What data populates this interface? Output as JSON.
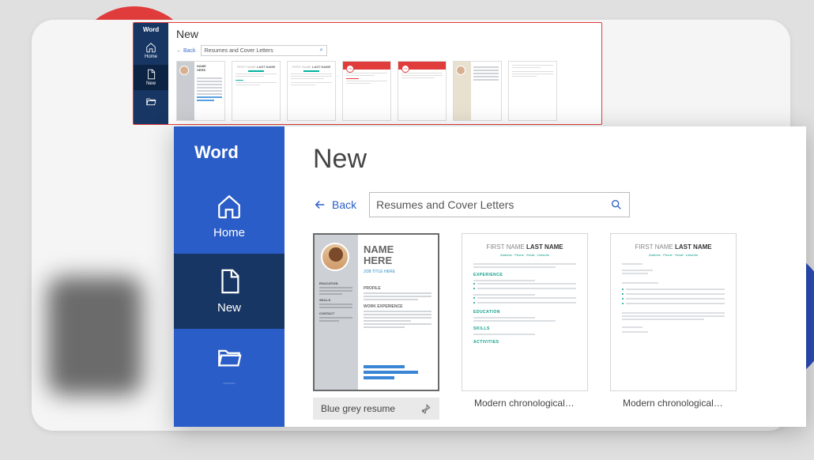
{
  "app_brand": "Word",
  "page_title": "New",
  "nav": {
    "home": "Home",
    "new": "New",
    "open": "Open"
  },
  "back_label": "Back",
  "search": {
    "value": "Resumes and Cover Letters"
  },
  "templates_big": [
    {
      "label": "Blue grey resume",
      "name_line1": "NAME",
      "name_line2": "HERE",
      "subtitle": "JOB TITLE HERE"
    },
    {
      "label": "Modern chronological resu...",
      "first": "FIRST NAME",
      "last": "LAST NAME"
    },
    {
      "label": "Modern chronological cov...",
      "first": "FIRST NAME",
      "last": "LAST NAME"
    }
  ],
  "templates_small_count": 7,
  "colors": {
    "sidebar_blue": "#2a5dc7",
    "sidebar_dark": "#173663",
    "accent_teal": "#0a9e88",
    "accent_red": "#e13c3c"
  }
}
